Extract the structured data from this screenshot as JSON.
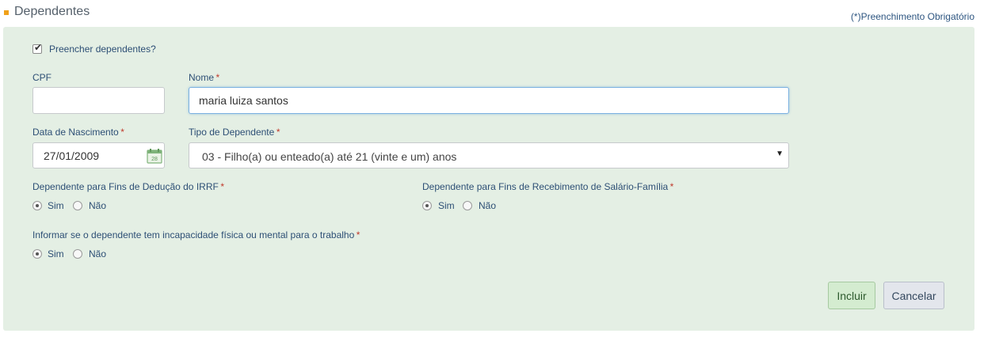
{
  "section": {
    "title": "Dependentes",
    "required_note": "(*)Preenchimento Obrigatório"
  },
  "form": {
    "fill_dependents": {
      "label": "Preencher dependentes?",
      "checked": true
    },
    "cpf": {
      "label": "CPF",
      "value": ""
    },
    "nome": {
      "label": "Nome",
      "required": "*",
      "value": "maria luiza santos"
    },
    "data_nascimento": {
      "label": "Data de Nascimento",
      "required": "*",
      "value": "27/01/2009"
    },
    "calendar_day": "28",
    "tipo_dependente": {
      "label": "Tipo de Dependente",
      "required": "*",
      "value": "03 - Filho(a) ou enteado(a) até 21 (vinte e um) anos",
      "arrow": "▼"
    },
    "irrf": {
      "label": "Dependente para Fins de Dedução do IRRF",
      "required": "*",
      "selected": "Sim",
      "opt_yes": "Sim",
      "opt_no": "Não"
    },
    "salario_familia": {
      "label": "Dependente para Fins de Recebimento de Salário-Família",
      "required": "*",
      "selected": "Sim",
      "opt_yes": "Sim",
      "opt_no": "Não"
    },
    "incapacidade": {
      "label": "Informar se o dependente tem incapacidade física ou mental para o trabalho",
      "required": "*",
      "selected": "Sim",
      "opt_yes": "Sim",
      "opt_no": "Não"
    }
  },
  "actions": {
    "incluir": "Incluir",
    "cancelar": "Cancelar"
  },
  "colors": {
    "accent": "#f0a11a",
    "panel_bg": "#e4efe4",
    "required_star": "#c0392b"
  }
}
